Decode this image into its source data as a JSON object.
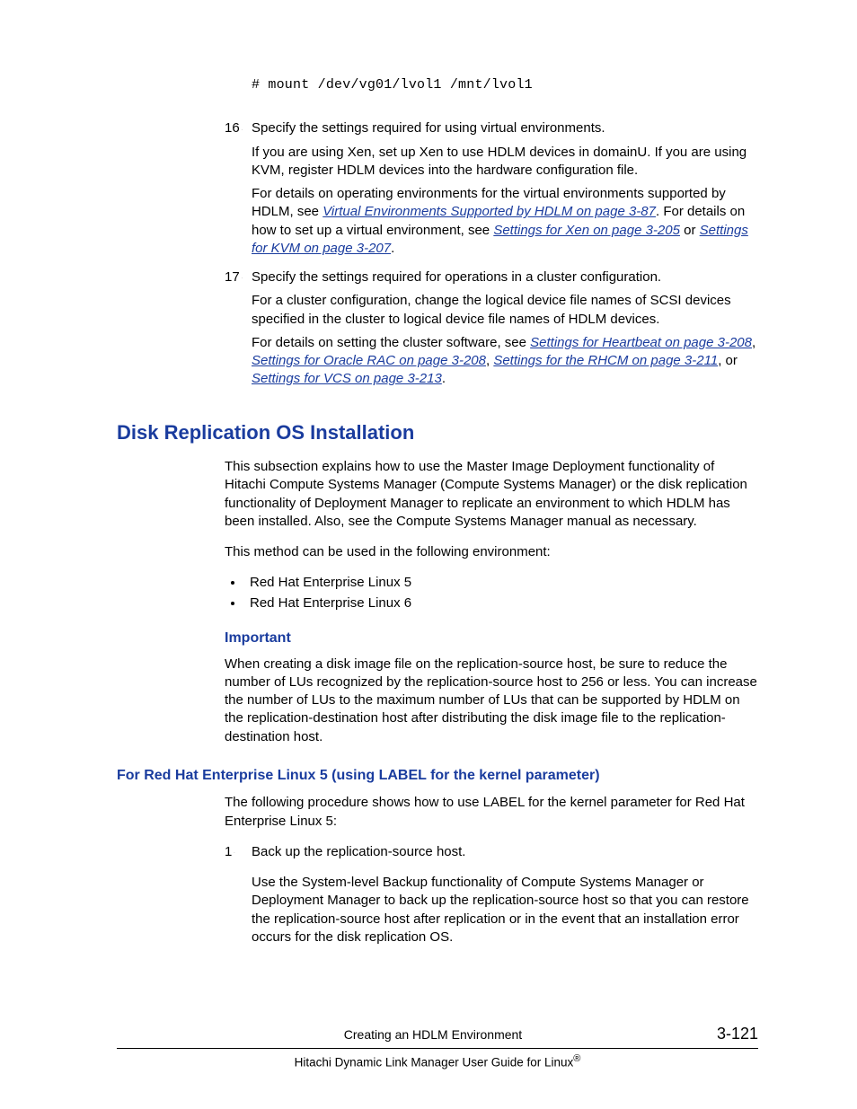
{
  "code_line": "# mount /dev/vg01/lvol1 /mnt/lvol1",
  "steps_a": [
    {
      "num": "16",
      "lead": "Specify the settings required for using virtual environments.",
      "p1": "If you are using Xen, set up Xen to use HDLM devices in domainU. If you are using KVM, register HDLM devices into the hardware configuration file.",
      "p2_pre": "For details on operating environments for the virtual environments supported by HDLM, see ",
      "p2_link1": "Virtual Environments Supported by HDLM on page 3-87",
      "p2_mid1": ". For details on how to set up a virtual environment, see ",
      "p2_link2": "Settings for Xen on page 3-205",
      "p2_mid2": " or ",
      "p2_link3": "Settings for KVM on page 3-207",
      "p2_end": "."
    },
    {
      "num": "17",
      "lead": "Specify the settings required for operations in a cluster configuration.",
      "p1": "For a cluster configuration, change the logical device file names of SCSI devices specified in the cluster to logical device file names of HDLM devices.",
      "p2_pre": "For details on setting the cluster software, see ",
      "p2_link1": "Settings for Heartbeat on page 3-208",
      "p2_mid1": ", ",
      "p2_link2": "Settings for Oracle RAC on page 3-208",
      "p2_mid2": ", ",
      "p2_link3": "Settings for the RHCM on page 3-211",
      "p2_mid3": ", or ",
      "p2_link4": "Settings for VCS on page 3-213",
      "p2_end": "."
    }
  ],
  "h2": "Disk Replication OS Installation",
  "intro_p1": "This subsection explains how to use the Master Image Deployment functionality of Hitachi Compute Systems Manager (Compute Systems Manager) or the disk replication functionality of Deployment Manager to replicate an environment to which HDLM has been installed. Also, see the Compute Systems Manager manual as necessary.",
  "intro_p2": "This method can be used in the following environment:",
  "env_list": [
    "Red Hat Enterprise Linux 5",
    "Red Hat Enterprise Linux 6"
  ],
  "important_h": "Important",
  "important_p": "When creating a disk image file on the replication-source host, be sure to reduce the number of LUs recognized by the replication-source host to 256 or less. You can increase the number of LUs to the maximum number of LUs that can be supported by HDLM on the replication-destination host after distributing the disk image file to the replication-destination host.",
  "sub_h": "For Red Hat Enterprise Linux 5 (using LABEL for the kernel parameter)",
  "sub_p": "The following procedure shows how to use LABEL for the kernel parameter for Red Hat Enterprise Linux 5:",
  "steps_b": [
    {
      "num": "1",
      "lead": "Back up the replication-source host.",
      "p1": "Use the System-level Backup functionality of Compute Systems Manager or Deployment Manager to back up the replication-source host so that you can restore the replication-source host after replication or in the event that an installation error occurs for the disk replication OS."
    }
  ],
  "footer_center": "Creating an HDLM Environment",
  "footer_page": "3-121",
  "footer_title_pre": "Hitachi Dynamic Link Manager User Guide for Linux",
  "footer_title_reg": "®"
}
